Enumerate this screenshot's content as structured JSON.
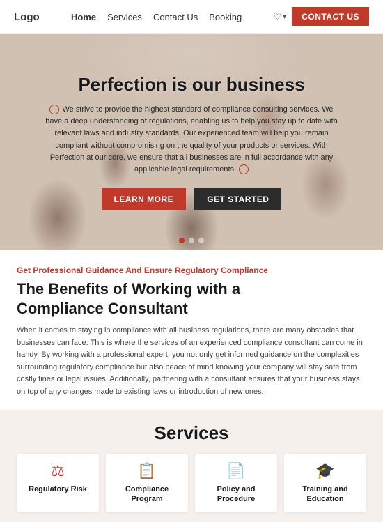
{
  "nav": {
    "logo": "Logo",
    "links": [
      {
        "label": "Home",
        "active": true
      },
      {
        "label": "Services",
        "active": false
      },
      {
        "label": "Contact Us",
        "active": false
      },
      {
        "label": "Booking",
        "active": false
      }
    ],
    "heart_label": "♡",
    "contact_btn": "CONTACT US"
  },
  "hero": {
    "title": "Perfection is our business",
    "description": "We strive to provide the highest standard of compliance consulting services. We have a deep understanding of regulations, enabling us to help you stay up to date with relevant laws and industry standards. Our experienced team will help you remain compliant without compromising on the quality of your products or services. With Perfection at our core, we ensure that all businesses are in full accordance with any applicable legal requirements.",
    "btn_learn": "LEARN MORE",
    "btn_started": "GET STARTED",
    "dots": [
      {
        "active": true
      },
      {
        "active": false
      },
      {
        "active": false
      }
    ]
  },
  "benefits": {
    "subtitle": "Get Professional Guidance And Ensure Regulatory Compliance",
    "title": "The Benefits of Working with a Compliance Consultant",
    "description": "When it comes to staying in compliance with all business regulations, there are many obstacles that businesses can face. This is where the services of an experienced compliance consultant can come in handy. By working with a professional expert, you not only get informed guidance on the complexities surrounding regulatory compliance but also peace of mind knowing your company will stay safe from costly fines or legal issues. Additionally, partnering with a consultant ensures that your business stays on top of any changes made to existing laws or introduction of new ones."
  },
  "services": {
    "title": "Services",
    "cards": [
      {
        "icon": "⚖",
        "name": "Regulatory Risk"
      },
      {
        "icon": "📋",
        "name": "Compliance Program"
      },
      {
        "icon": "📄",
        "name": "Policy and Procedure"
      },
      {
        "icon": "🎓",
        "name": "Training and Education"
      }
    ]
  }
}
